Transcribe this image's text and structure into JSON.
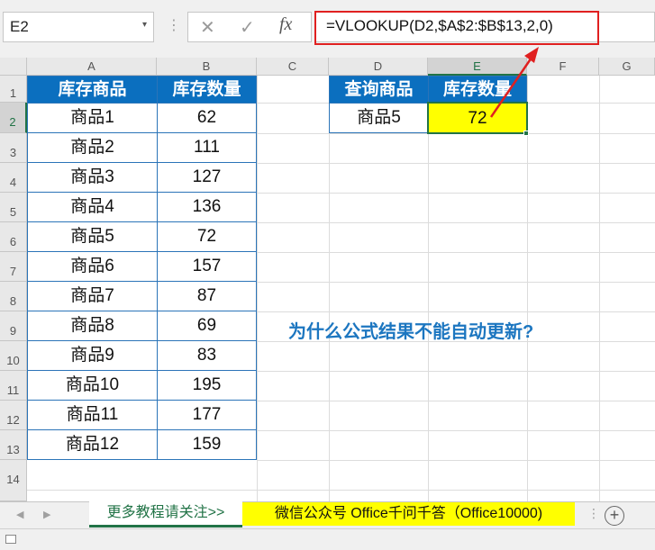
{
  "formula_bar": {
    "name_box": "E2",
    "name_box_dropdown": "▾",
    "grip": "⋮",
    "cancel_icon": "✕",
    "enter_icon": "✓",
    "fx_icon": "fx",
    "formula": "=VLOOKUP(D2,$A$2:$B$13,2,0)"
  },
  "columns": [
    "A",
    "B",
    "C",
    "D",
    "E",
    "F",
    "G"
  ],
  "rows": [
    "1",
    "2",
    "3",
    "4",
    "5",
    "6",
    "7",
    "8",
    "9",
    "10",
    "11",
    "12",
    "13",
    "14"
  ],
  "table1": {
    "headers": [
      "库存商品",
      "库存数量"
    ],
    "rows": [
      [
        "商品1",
        "62"
      ],
      [
        "商品2",
        "111"
      ],
      [
        "商品3",
        "127"
      ],
      [
        "商品4",
        "136"
      ],
      [
        "商品5",
        "72"
      ],
      [
        "商品6",
        "157"
      ],
      [
        "商品7",
        "87"
      ],
      [
        "商品8",
        "69"
      ],
      [
        "商品9",
        "83"
      ],
      [
        "商品10",
        "195"
      ],
      [
        "商品11",
        "177"
      ],
      [
        "商品12",
        "159"
      ]
    ]
  },
  "table2": {
    "headers": [
      "查询商品",
      "库存数量"
    ],
    "query": "商品5",
    "result": "72"
  },
  "question": "为什么公式结果不能自动更新?",
  "sheet_tabs": {
    "prev": "◀",
    "next": "▶",
    "tab1": "更多教程请关注>>",
    "tab2": "微信公众号 Office千问千答（Office10000)",
    "separator": "⋮",
    "add": "+"
  },
  "colors": {
    "header_blue": "#0b6fbf",
    "highlight_yellow": "#ffff00",
    "annotation_red": "#e02020",
    "question_blue": "#1c76c0",
    "excel_green": "#217346"
  }
}
